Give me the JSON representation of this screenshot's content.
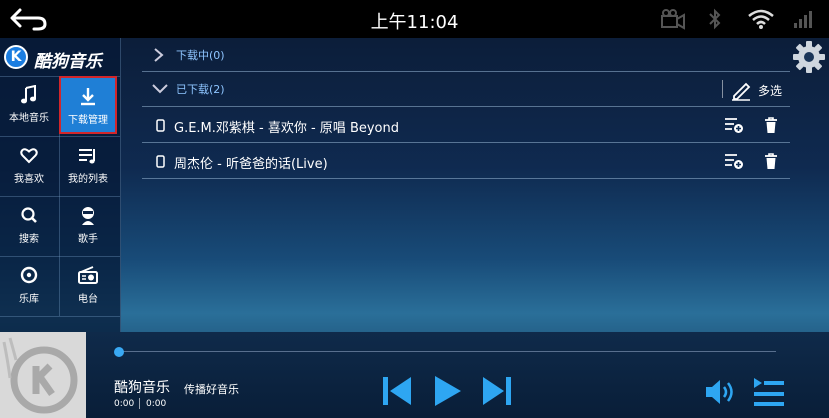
{
  "status_bar": {
    "time": "上午11:04"
  },
  "app": {
    "name": "酷狗音乐",
    "logo_letter": "K"
  },
  "sidebar": {
    "items": [
      {
        "label": "本地音乐",
        "icon": "music-note-icon",
        "active": false
      },
      {
        "label": "下载管理",
        "icon": "download-icon",
        "active": true
      },
      {
        "label": "我喜欢",
        "icon": "heart-icon",
        "active": false
      },
      {
        "label": "我的列表",
        "icon": "playlist-icon",
        "active": false
      },
      {
        "label": "搜索",
        "icon": "search-icon",
        "active": false
      },
      {
        "label": "歌手",
        "icon": "singer-icon",
        "active": false
      },
      {
        "label": "乐库",
        "icon": "disc-icon",
        "active": false
      },
      {
        "label": "电台",
        "icon": "radio-icon",
        "active": false
      }
    ]
  },
  "downloads": {
    "downloading_label": "下载中(0)",
    "downloaded_label": "已下载(2)",
    "multi_select_label": "多选",
    "songs": [
      {
        "title": "G.E.M.邓紫棋 - 喜欢你 - 原唱 Beyond"
      },
      {
        "title": "周杰伦 - 听爸爸的话(Live)"
      }
    ]
  },
  "player": {
    "app_name": "酷狗音乐",
    "slogan": "传播好音乐",
    "elapsed": "0:00",
    "duration": "0:00",
    "progress": 0
  },
  "colors": {
    "accent": "#39a9f4",
    "active_tab": "#1f7fd6",
    "active_border": "#d2262b",
    "section_text": "#8ec5ff"
  }
}
